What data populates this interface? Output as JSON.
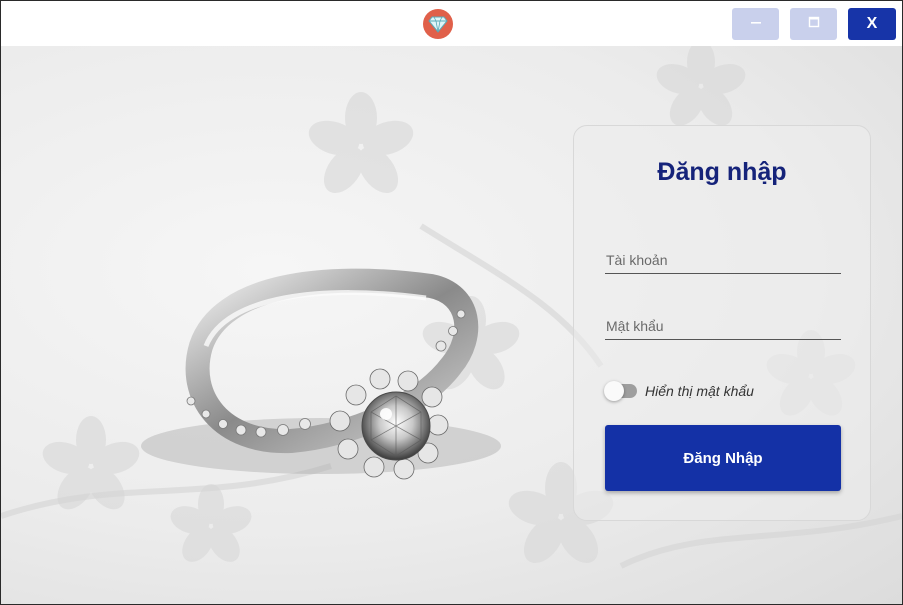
{
  "window": {
    "logo_icon": "diamond-icon",
    "minimize_icon": "minimize-icon",
    "maximize_icon": "maximize-icon",
    "close_label": "X"
  },
  "login": {
    "title": "Đăng nhập",
    "username_placeholder": "Tài khoản",
    "username_value": "",
    "password_placeholder": "Mật khẩu",
    "password_value": "",
    "show_password_label": "Hiển thị mật khẩu",
    "show_password_on": false,
    "submit_label": "Đăng Nhập"
  },
  "colors": {
    "accent": "#1431a6",
    "title": "#15237a",
    "window_button": "#c9d0ec",
    "logo": "#e0604a"
  }
}
